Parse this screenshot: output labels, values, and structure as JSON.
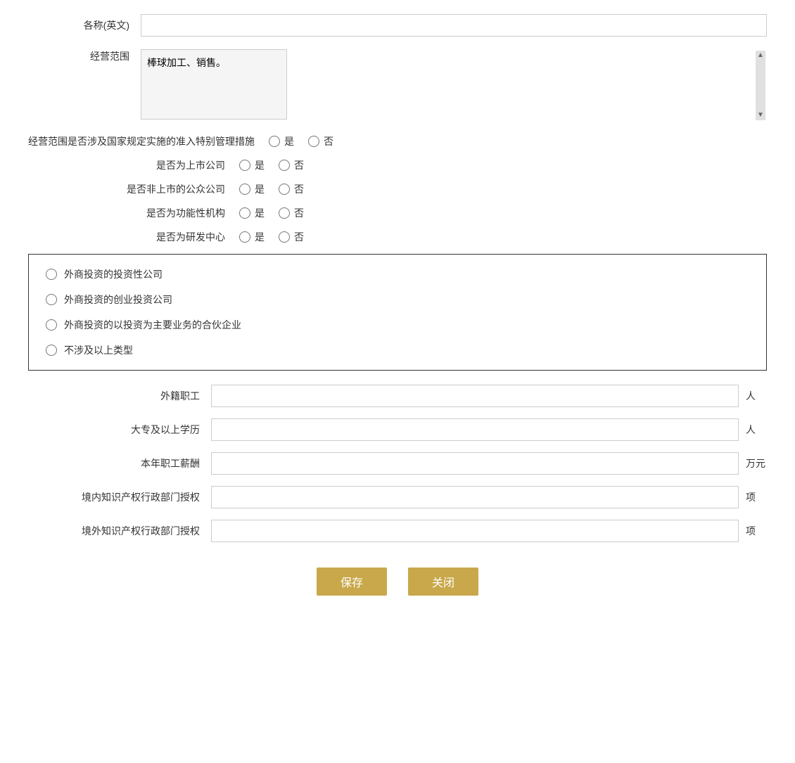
{
  "form": {
    "name_en_label": "各称(英文)",
    "name_en_value": "",
    "business_scope_label": "经营范围",
    "business_scope_value": "棒球加工、销售。",
    "special_management_label": "经营范围是否涉及国家规定实施的准入特别管理措施",
    "listed_company_label": "是否为上市公司",
    "non_listed_public_label": "是否非上市的公众公司",
    "functional_org_label": "是否为功能性机构",
    "rd_center_label": "是否为研发中心",
    "radio_yes": "是",
    "radio_no": "否",
    "box_options": [
      "外商投资的投资性公司",
      "外商投资的创业投资公司",
      "外商投资的以投资为主要业务的合伙企业",
      "不涉及以上类型"
    ],
    "foreign_workers_label": "外籍职工",
    "foreign_workers_unit": "人",
    "college_above_label": "大专及以上学历",
    "college_above_unit": "人",
    "annual_salary_label": "本年职工薪酬",
    "annual_salary_unit": "万元",
    "domestic_ip_label": "境内知识产权行政部门授权",
    "domestic_ip_unit": "项",
    "foreign_ip_label": "境外知识产权行政部门授权",
    "foreign_ip_unit": "项",
    "save_button": "保存",
    "close_button": "关闭"
  }
}
